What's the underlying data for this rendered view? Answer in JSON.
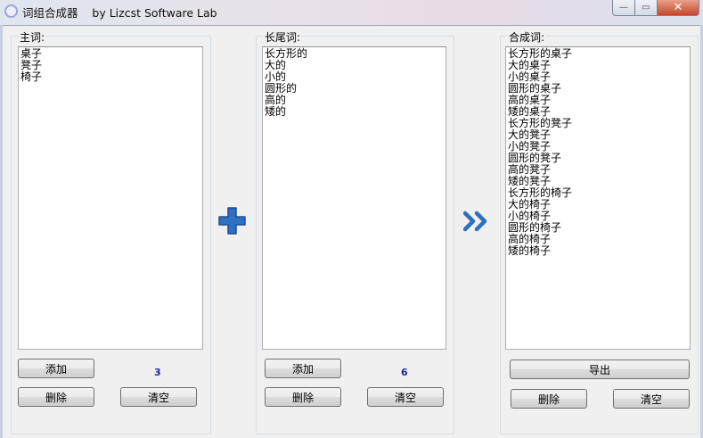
{
  "window": {
    "title": "词组合成器    by Lizcst Software Lab",
    "minimize": "—",
    "maximize": "▭",
    "close": "✕"
  },
  "main": {
    "label": "主词:",
    "items": [
      "桌子",
      "凳子",
      "椅子"
    ],
    "add": "添加",
    "delete": "删除",
    "clear": "清空",
    "count": "3"
  },
  "tail": {
    "label": "长尾词:",
    "items": [
      "长方形的",
      "大的",
      "小的",
      "圆形的",
      "高的",
      "矮的"
    ],
    "add": "添加",
    "delete": "删除",
    "clear": "清空",
    "count": "6"
  },
  "result": {
    "label": "合成词:",
    "items": [
      "长方形的桌子",
      "大的桌子",
      "小的桌子",
      "圆形的桌子",
      "高的桌子",
      "矮的桌子",
      "长方形的凳子",
      "大的凳子",
      "小的凳子",
      "圆形的凳子",
      "高的凳子",
      "矮的凳子",
      "长方形的椅子",
      "大的椅子",
      "小的椅子",
      "圆形的椅子",
      "高的椅子",
      "矮的椅子"
    ],
    "export": "导出",
    "delete": "删除",
    "clear": "清空"
  },
  "colors": {
    "accent": "#2f6fc0",
    "count": "#1a2a9a"
  }
}
